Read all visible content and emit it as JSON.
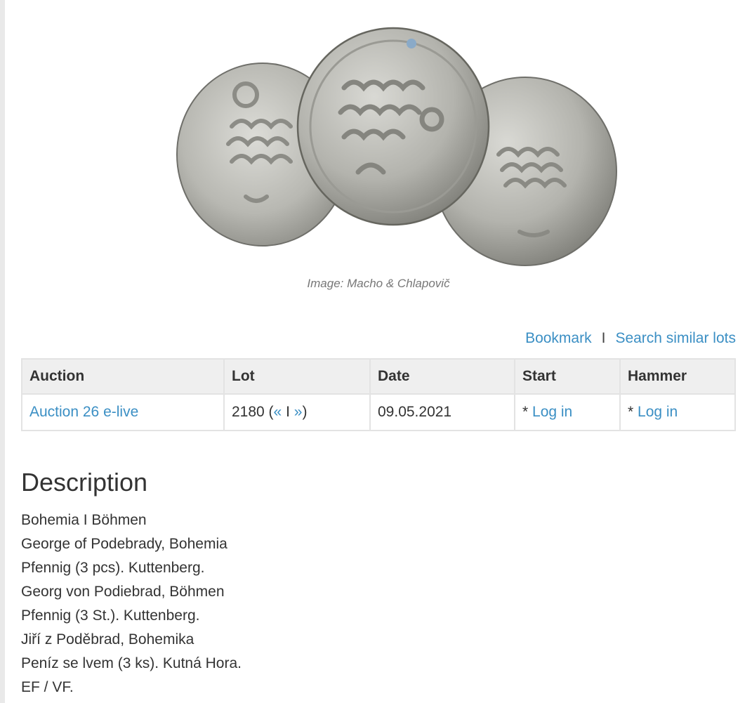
{
  "image": {
    "alt": "Three silver pfennig coins",
    "caption": "Image: Macho & Chlapovič"
  },
  "actions": {
    "bookmark": "Bookmark",
    "separator": "I",
    "search_similar": "Search similar lots"
  },
  "table": {
    "headers": {
      "auction": "Auction",
      "lot": "Lot",
      "date": "Date",
      "start": "Start",
      "hammer": "Hammer"
    },
    "row": {
      "auction": "Auction 26 e-live",
      "lot_number": "2180",
      "lot_prev": "«",
      "lot_sep": "I",
      "lot_next": "»",
      "date": "09.05.2021",
      "start_prefix": "* ",
      "start_link": "Log in",
      "hammer_prefix": "* ",
      "hammer_link": "Log in"
    }
  },
  "description": {
    "title": "Description",
    "lines": [
      "Bohemia I Böhmen",
      "George of Podebrady, Bohemia",
      "Pfennig (3 pcs). Kuttenberg.",
      "Georg von Podiebrad, Böhmen",
      "Pfennig (3 St.). Kuttenberg.",
      "Jiří z Poděbrad, Bohemika",
      "Peníz se lvem (3 ks). Kutná Hora.",
      "EF / VF."
    ]
  },
  "colors": {
    "link": "#3b8fc4",
    "header_bg": "#efefef",
    "border": "#e3e3e3",
    "caption": "#777777"
  }
}
